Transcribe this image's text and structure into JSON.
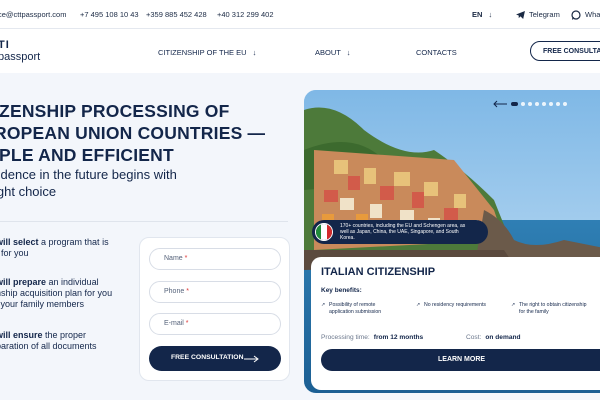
{
  "topbar": {
    "email": "ce@cttpassport.com",
    "phones": [
      "+7 495 108 10 43",
      "+359 885 452 428",
      "+40 312 299 402"
    ],
    "language": "EN",
    "telegram": "Telegram",
    "whatsapp": "Wha"
  },
  "header": {
    "logo_top": "TI",
    "logo_bottom": "passport",
    "nav": [
      "CITIZENSHIP OF THE EU",
      "ABOUT",
      "CONTACTS"
    ],
    "cta": "FREE CONSULTATIO"
  },
  "hero": {
    "title_lines": [
      "IZENSHIP PROCESSING OF",
      "ROPEAN UNION COUNTRIES —",
      "IPLE AND EFFICIENT"
    ],
    "subtitle_lines": [
      "fidence in the future begins with",
      "ight choice"
    ]
  },
  "steps": [
    {
      "bold": "will select",
      "rest": " a program that is",
      "line2": "t for you"
    },
    {
      "bold": "will prepare",
      "rest": " an individual",
      "line2": "nship acquisition plan for you",
      "line3": "l your family members"
    },
    {
      "bold": "will ensure",
      "rest": " the proper",
      "line2": "paration of all documents"
    }
  ],
  "form": {
    "name": "Name",
    "phone": "Phone",
    "email": "E-mail",
    "required_mark": "*",
    "submit": "FREE CONSULTATION"
  },
  "card": {
    "info_text": [
      "170+ countries, including the EU and Schengen area, as",
      "well as Japan, China, the UAE, Singapore, and South",
      "Korea."
    ],
    "title": "ITALIAN CITIZENSHIP",
    "key_benefits": "Key benefits:",
    "benefits": [
      [
        "Possibility of remote",
        "application submission"
      ],
      [
        "No residency requirements"
      ],
      [
        "The right to obtain citizenship",
        "for the family"
      ]
    ],
    "processing_label": "Processing time:",
    "processing_value": "from 12 months",
    "cost_label": "Cost:",
    "cost_value": "on demand",
    "learn_more": "LEARN MORE",
    "slides": 8,
    "active_slide": 1
  },
  "colors": {
    "navy": "#13264a",
    "flag_green": "#1f8b3a",
    "flag_red": "#d22b2b",
    "required": "#dd3333"
  }
}
